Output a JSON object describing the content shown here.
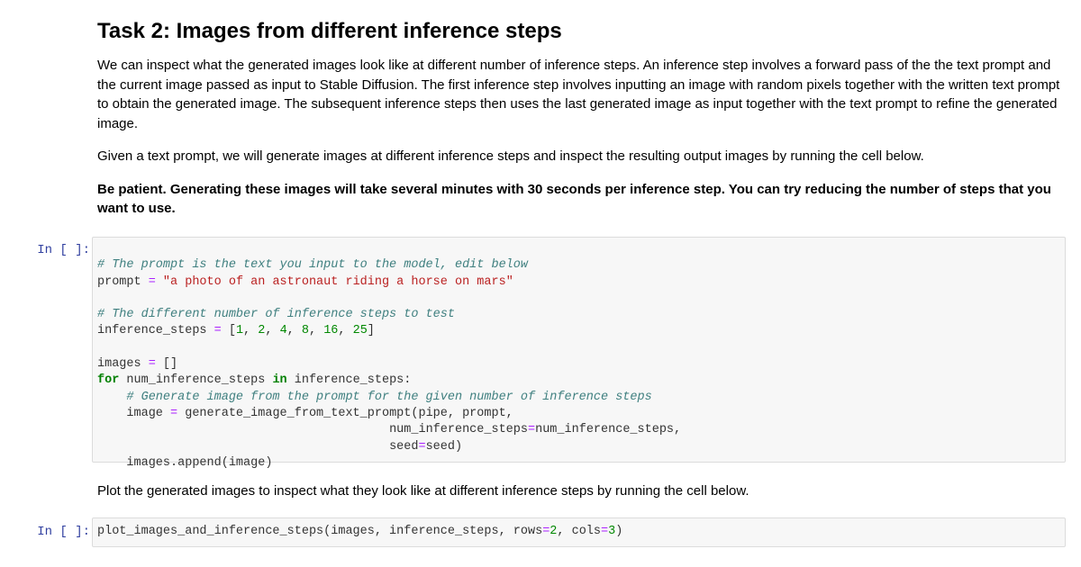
{
  "markdown": {
    "title": "Task 2: Images from different inference steps",
    "para1": "We can inspect what the generated images look like at different number of inference steps. An inference step involves a forward pass of the the text prompt and the current image passed as input to Stable Diffusion. The first inference step involves inputting an image with random pixels together with the written text prompt to obtain the generated image. The subsequent inference steps then uses the last generated image as input together with the text prompt to refine the generated image.",
    "para2": "Given a text prompt, we will generate images at different inference steps and inspect the resulting output images by running the cell below.",
    "para3": "Be patient. Generating these images will take several minutes with 30 seconds per inference step. You can try reducing the number of steps that you want to use.",
    "para4": "Plot the generated images to inspect what they look like at different inference steps by running the cell below."
  },
  "cells": [
    {
      "prompt": "In [ ]:",
      "lines": {
        "l1_comment": "# The prompt is the text you input to the model, edit below",
        "l2_var": "prompt ",
        "l2_eq": "=",
        "l2_str": " \"a photo of an astronaut riding a horse on mars\"",
        "l4_comment": "# The different number of inference steps to test",
        "l5_var": "inference_steps ",
        "l5_eq": "=",
        "l5_open": " [",
        "steps": [
          "1",
          "2",
          "4",
          "8",
          "16",
          "25"
        ],
        "l5_close": "]",
        "l7_var": "images ",
        "l7_eq": "=",
        "l7_rest": " []",
        "l8_for": "for",
        "l8_mid": " num_inference_steps ",
        "l8_in": "in",
        "l8_rest": " inference_steps:",
        "l9_comment": "    # Generate image from the prompt for the given number of inference steps",
        "l10_var": "    image ",
        "l10_eq": "=",
        "l10_rest": " generate_image_from_text_prompt(pipe, prompt,",
        "l11_pad": "                                        ",
        "l11_a": "num_inference_steps",
        "l11_eq": "=",
        "l11_b": "num_inference_steps,",
        "l12_pad": "                                        ",
        "l12_a": "seed",
        "l12_eq": "=",
        "l12_b": "seed)",
        "l13": "    images.append(image)"
      }
    },
    {
      "prompt": "In [ ]:",
      "lines": {
        "a": "plot_images_and_inference_steps(images, inference_steps, rows",
        "eq1": "=",
        "n1": "2",
        "b": ", cols",
        "eq2": "=",
        "n2": "3",
        "c": ")"
      }
    }
  ]
}
